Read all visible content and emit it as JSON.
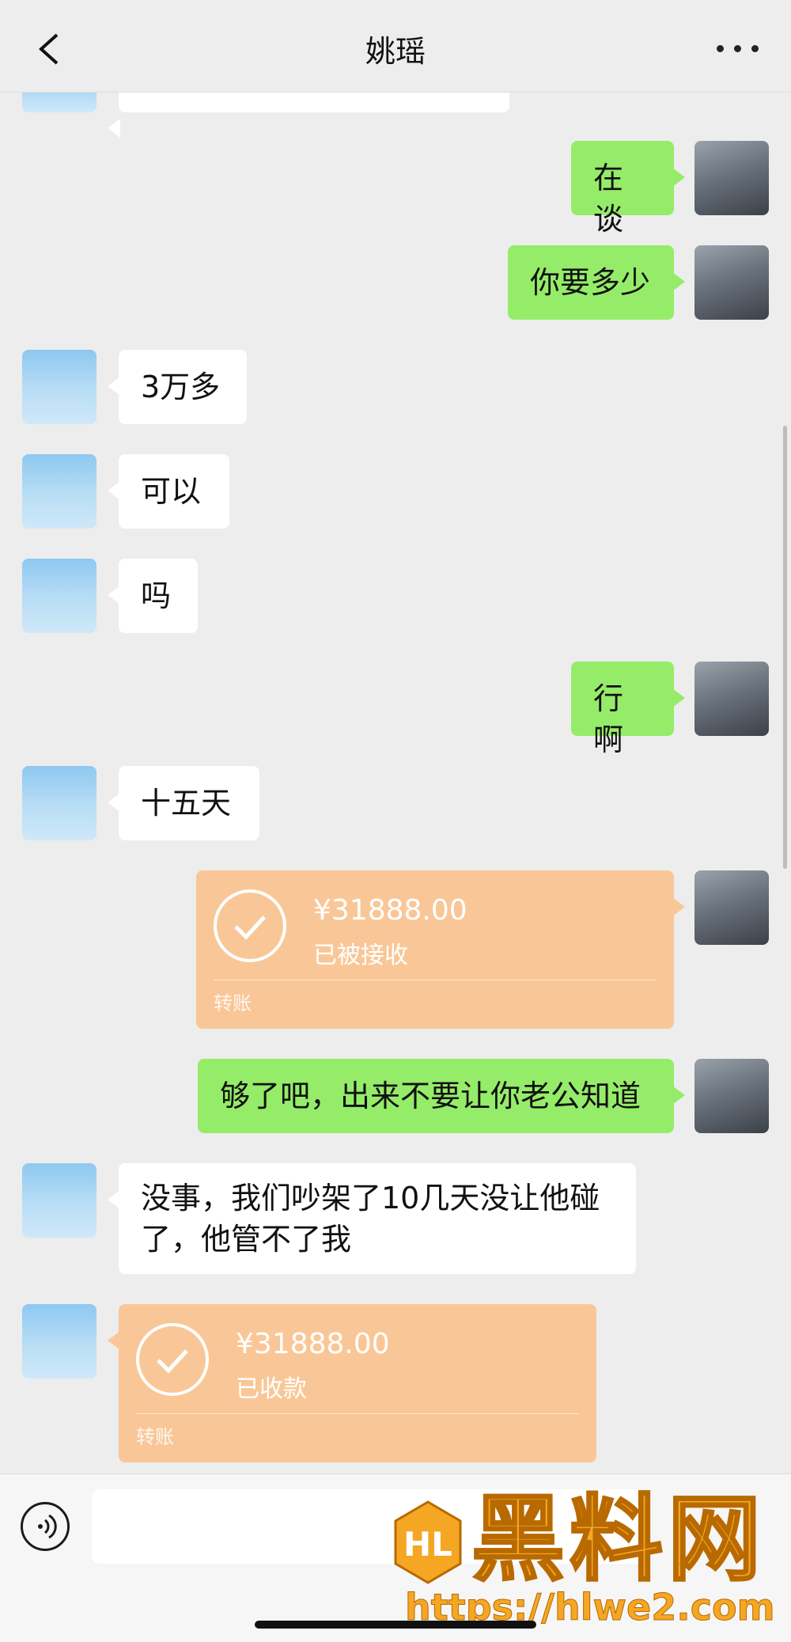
{
  "header": {
    "title": "姚瑶",
    "back_icon": "chevron-left-icon",
    "more_icon": "more-icon"
  },
  "messages": [
    {
      "side": "right",
      "type": "text",
      "text": "在谈"
    },
    {
      "side": "right",
      "type": "text",
      "text": "你要多少"
    },
    {
      "side": "left",
      "type": "text",
      "text": "3万多"
    },
    {
      "side": "left",
      "type": "text",
      "text": "可以"
    },
    {
      "side": "left",
      "type": "text",
      "text": "吗"
    },
    {
      "side": "right",
      "type": "text",
      "text": "行啊"
    },
    {
      "side": "left",
      "type": "text",
      "text": "十五天"
    },
    {
      "side": "right",
      "type": "transfer",
      "amount": "¥31888.00",
      "status": "已被接收",
      "label": "转账"
    },
    {
      "side": "right",
      "type": "text",
      "text": "够了吧，出来不要让你老公知道"
    },
    {
      "side": "left",
      "type": "text",
      "line1": "没事，我们吵架了10几天没让他碰",
      "line2": "了，他管不了我"
    },
    {
      "side": "left",
      "type": "transfer",
      "amount": "¥31888.00",
      "status": "已收款",
      "label": "转账"
    }
  ],
  "input_bar": {
    "voice_icon": "voice-icon",
    "placeholder": ""
  },
  "watermark": {
    "text": "黑料网",
    "url": "https://hlwe2.com"
  },
  "colors": {
    "green_bubble": "#95ec69",
    "white_bubble": "#ffffff",
    "transfer": "#f9c797",
    "background": "#ededed"
  }
}
